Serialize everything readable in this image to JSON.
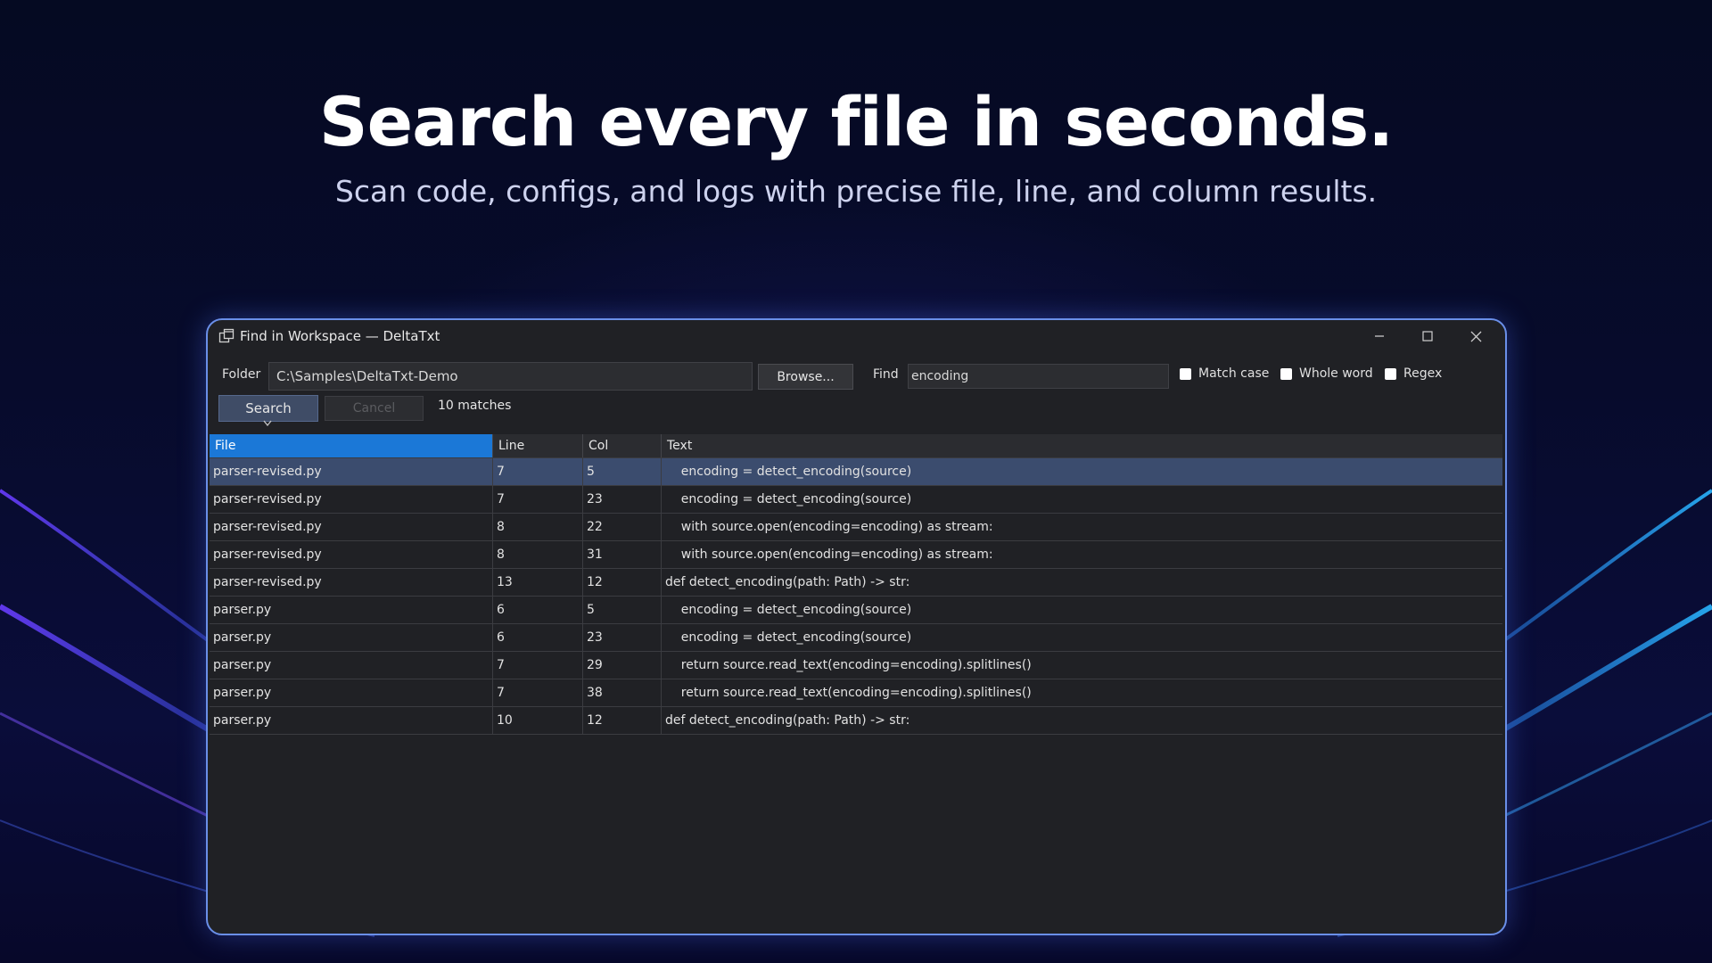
{
  "hero": {
    "headline": "Search every file in seconds.",
    "subhead": "Scan code, configs, and logs with precise file, line, and column results."
  },
  "window": {
    "title": "Find in Workspace — DeltaTxt",
    "icon": "app-window-icon",
    "controls": [
      "minimize-icon",
      "maximize-icon",
      "close-icon"
    ]
  },
  "toolbar": {
    "folder_label": "Folder",
    "folder_value": "C:\\Samples\\DeltaTxt-Demo",
    "browse_label": "Browse...",
    "find_label": "Find",
    "find_value": "encoding",
    "match_case_label": "Match case",
    "whole_word_label": "Whole word",
    "regex_label": "Regex",
    "search_label": "Search",
    "cancel_label": "Cancel",
    "matches_text": "10 matches"
  },
  "results": {
    "columns": [
      "File",
      "Line",
      "Col",
      "Text"
    ],
    "rows": [
      {
        "file": "parser-revised.py",
        "line": "7",
        "col": "5",
        "text": "    encoding = detect_encoding(source)"
      },
      {
        "file": "parser-revised.py",
        "line": "7",
        "col": "23",
        "text": "    encoding = detect_encoding(source)"
      },
      {
        "file": "parser-revised.py",
        "line": "8",
        "col": "22",
        "text": "    with source.open(encoding=encoding) as stream:"
      },
      {
        "file": "parser-revised.py",
        "line": "8",
        "col": "31",
        "text": "    with source.open(encoding=encoding) as stream:"
      },
      {
        "file": "parser-revised.py",
        "line": "13",
        "col": "12",
        "text": "def detect_encoding(path: Path) -> str:"
      },
      {
        "file": "parser.py",
        "line": "6",
        "col": "5",
        "text": "    encoding = detect_encoding(source)"
      },
      {
        "file": "parser.py",
        "line": "6",
        "col": "23",
        "text": "    encoding = detect_encoding(source)"
      },
      {
        "file": "parser.py",
        "line": "7",
        "col": "29",
        "text": "    return source.read_text(encoding=encoding).splitlines()"
      },
      {
        "file": "parser.py",
        "line": "7",
        "col": "38",
        "text": "    return source.read_text(encoding=encoding).splitlines()"
      },
      {
        "file": "parser.py",
        "line": "10",
        "col": "12",
        "text": "def detect_encoding(path: Path) -> str:"
      }
    ]
  },
  "colors": {
    "accent": "#1b78d7",
    "selected_row": "#3b4c6e",
    "window_border": "#6a8fe8"
  }
}
